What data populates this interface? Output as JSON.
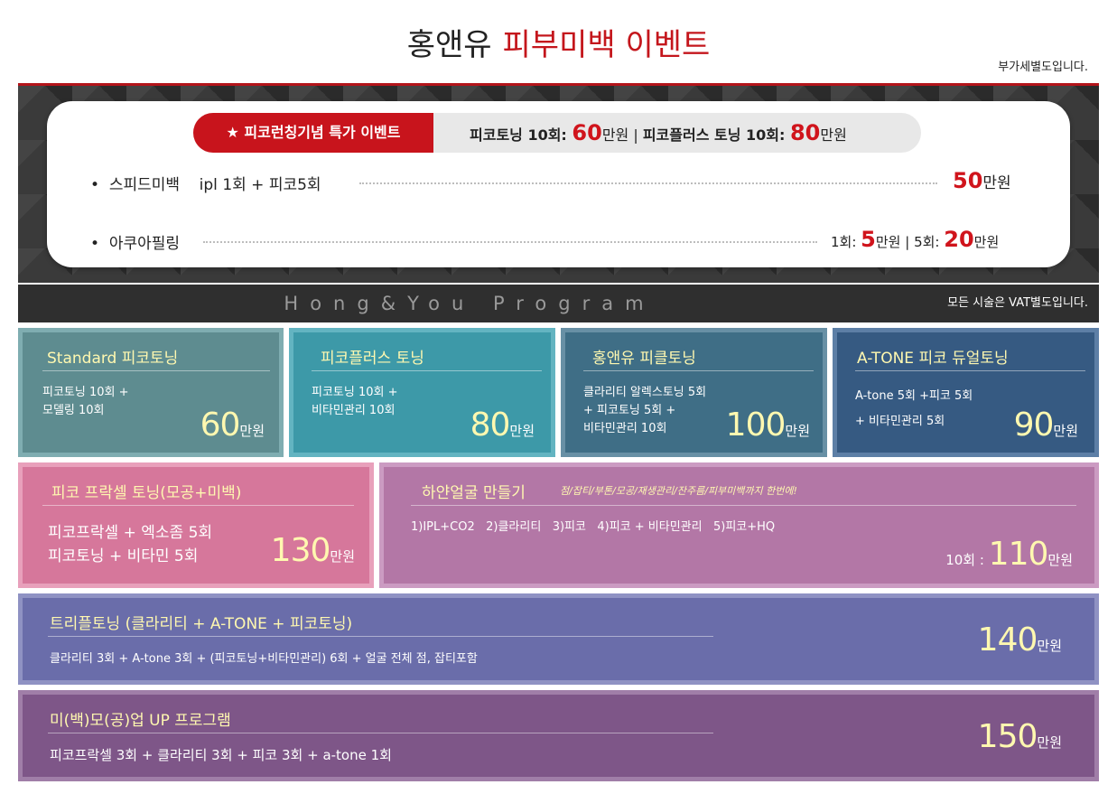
{
  "header": {
    "title_part1": "홍앤유",
    "title_part2": "피부미백 이벤트",
    "vat_note": "부가세별도입니다."
  },
  "promo": {
    "badge": "★ 피코런칭기념 특가 이벤트",
    "item1_label": "피코토닝 10회: ",
    "item1_price": "60",
    "item1_unit": "만원",
    "separator": " | ",
    "item2_label": "피코플러스 토닝 10회: ",
    "item2_price": "80",
    "item2_unit": "만원"
  },
  "events": [
    {
      "bullet": "•",
      "name": "스피드미백",
      "detail": "ipl 1회 + 피코5회",
      "price": "50",
      "unit": "만원"
    },
    {
      "bullet": "•",
      "name": "아쿠아필링",
      "price1_label": "1회: ",
      "price1": "5",
      "price1_unit": "만원",
      "sep": " | ",
      "price2_label": "5회: ",
      "price2": "20",
      "price2_unit": "만원"
    }
  ],
  "program": {
    "title": "Hong&You Program",
    "vat_note": "모든 시술은 VAT별도입니다."
  },
  "cards": [
    {
      "title": "Standard 피코토닝",
      "desc": "피코토닝 10회 +\n모델링 10회",
      "price": "60",
      "unit": "만원"
    },
    {
      "title": "피코플러스 토닝",
      "desc": "피코토닝 10회 +\n비타민관리 10회",
      "price": "80",
      "unit": "만원"
    },
    {
      "title": "홍앤유 피클토닝",
      "desc": "클라리티 알렉스토닝 5회\n + 피코토닝 5회 +\n비타민관리 10회",
      "price": "100",
      "unit": "만원"
    },
    {
      "title": "A-TONE 피코 듀얼토닝",
      "desc": "A-tone 5회 +피코 5회\n+ 비타민관리 5회",
      "price": "90",
      "unit": "만원"
    },
    {
      "title": "피코 프락셀 토닝(모공+미백)",
      "desc": "피코프락셀 + 엑소좀 5회\n피코토닝 + 비타민 5회",
      "price": "130",
      "unit": "만원"
    },
    {
      "title": "하얀얼굴 만들기",
      "subtitle": "점/잡티/부톤/모공/재생관리/잔주름/피부미백까지 한번에!",
      "desc": "1)IPL+CO2   2)클라리티   3)피코   4)피코 + 비타민관리   5)피코+HQ",
      "price_label": "10회 : ",
      "price": "110",
      "unit": "만원"
    },
    {
      "title": "트리플토닝 (클라리티 + A-TONE + 피코토닝)",
      "desc": "클라리티 3회 + A-tone 3회 + (피코토닝+비타민관리) 6회 + 얼굴 전체 점, 잡티포함",
      "price": "140",
      "unit": "만원"
    },
    {
      "title": "미(백)모(공)업 UP 프로그램",
      "desc": "피코프락셀 3회 + 클라리티 3회 + 피코 3회 + a-tone 1회",
      "price": "150",
      "unit": "만원"
    }
  ],
  "colors": {
    "accent_red": "#c8141c",
    "price_yellow": "#fff8b0"
  }
}
